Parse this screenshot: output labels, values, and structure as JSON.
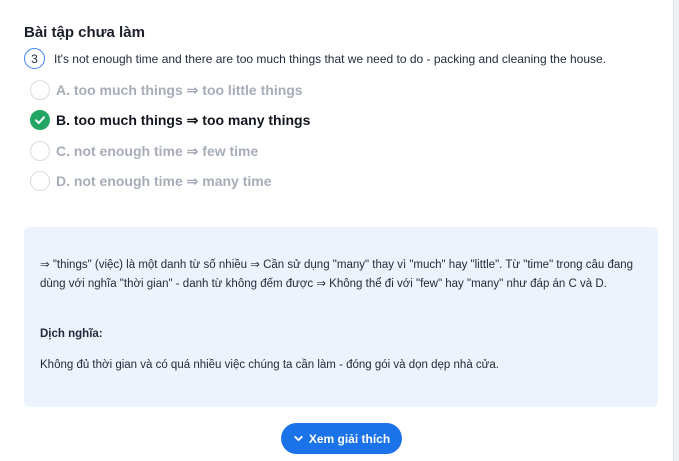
{
  "section": {
    "title": "Bài tập chưa làm"
  },
  "question": {
    "number": "3",
    "text": "It's not enough time and there are too much things that we need to do - packing and cleaning the house."
  },
  "options": [
    {
      "label": "A. too much things ⇒ too little things",
      "state": "unselected"
    },
    {
      "label": "B. too much things ⇒ too many things",
      "state": "correct"
    },
    {
      "label": "C. not enough time ⇒ few time",
      "state": "unselected"
    },
    {
      "label": "D. not enough time ⇒ many time",
      "state": "unselected"
    }
  ],
  "explanation": {
    "text": "⇒ \"things\" (việc) là một danh từ số nhiều ⇒ Cần sử dụng \"many\" thay vì \"much\" hay \"little\". Từ \"time\" trong câu đang dùng với nghĩa \"thời gian\" - danh từ không đếm được ⇒ Không thể đi với \"few\" hay \"many\" như đáp án C và D.",
    "translation_heading": "Dịch nghĩa:",
    "translation": "Không đủ thời gian và có quá nhiều việc chúng ta cần làm - đóng gói và dọn dẹp nhà cửa."
  },
  "button": {
    "label": "Xem giải thích",
    "icon": "chevron-down-icon"
  },
  "colors": {
    "accent": "#1a73e8",
    "correct": "#22a565",
    "panel": "#edf3fd",
    "muted": "#a7adb8"
  }
}
